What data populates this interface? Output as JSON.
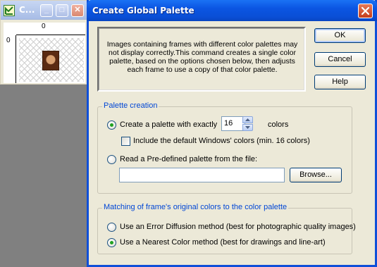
{
  "background_window": {
    "title": "C...",
    "ruler_h_label": "0",
    "ruler_v_label": "0",
    "minimize_glyph": "_",
    "maximize_glyph": "□",
    "close_glyph": "✕"
  },
  "dialog": {
    "title": "Create Global Palette",
    "description": "Images containing frames with different color palettes may not display correctly.This command creates a single color palette, based on the options chosen below, then adjusts each frame to use a copy of that color palette.",
    "buttons": {
      "ok": "OK",
      "cancel": "Cancel",
      "help": "Help"
    },
    "palette_creation": {
      "label": "Palette creation",
      "option_exact": "Create a palette with exactly",
      "colors_count": "16",
      "colors_unit": "colors",
      "include_windows": "Include the default Windows' colors (min. 16 colors)",
      "option_file": "Read a Pre-defined palette from the file:",
      "file_path": "",
      "browse": "Browse..."
    },
    "matching": {
      "label": "Matching of frame's original colors to the color palette",
      "option_error_diffusion": "Use an Error Diffusion method (best for photographic quality images)",
      "option_nearest": "Use a Nearest Color method (best for drawings and line-art)"
    }
  }
}
